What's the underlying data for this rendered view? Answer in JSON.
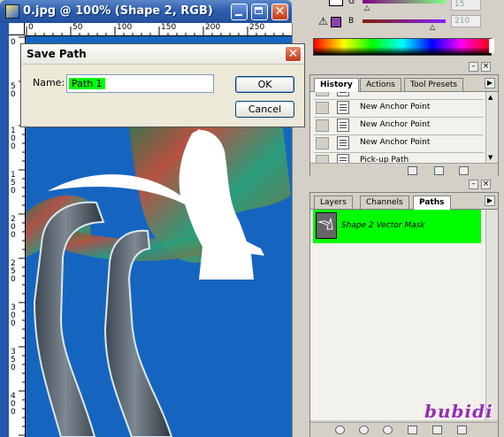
{
  "document": {
    "title": "0.jpg @ 100% (Shape 2, RGB)",
    "h_ruler_labels": [
      "0",
      "50",
      "100",
      "150",
      "200",
      "250"
    ],
    "v_ruler_labels": [
      "0",
      "50",
      "100",
      "150",
      "200",
      "250",
      "300",
      "350",
      "400"
    ]
  },
  "dialog": {
    "title": "Save Path",
    "name_label": "Name:",
    "name_value": "Path 1",
    "ok_label": "OK",
    "cancel_label": "Cancel",
    "selection_color": "#00ff00"
  },
  "color_panel": {
    "g_label": "G",
    "g_value": "15",
    "b_label": "B",
    "b_value": "210",
    "swatch_color": "#8e44ad"
  },
  "history_panel": {
    "tabs": [
      "History",
      "Actions",
      "Tool Presets"
    ],
    "active_tab": "History",
    "items": [
      "New Anchor Point",
      "New Anchor Point",
      "New Anchor Point",
      "Pick-up Path"
    ]
  },
  "paths_panel": {
    "tabs": [
      "Layers",
      "Channels",
      "Paths"
    ],
    "active_tab": "Paths",
    "item_label": "Shape 2 Vector Mask",
    "highlight_color": "#00ff00"
  },
  "watermark": "bubidi"
}
